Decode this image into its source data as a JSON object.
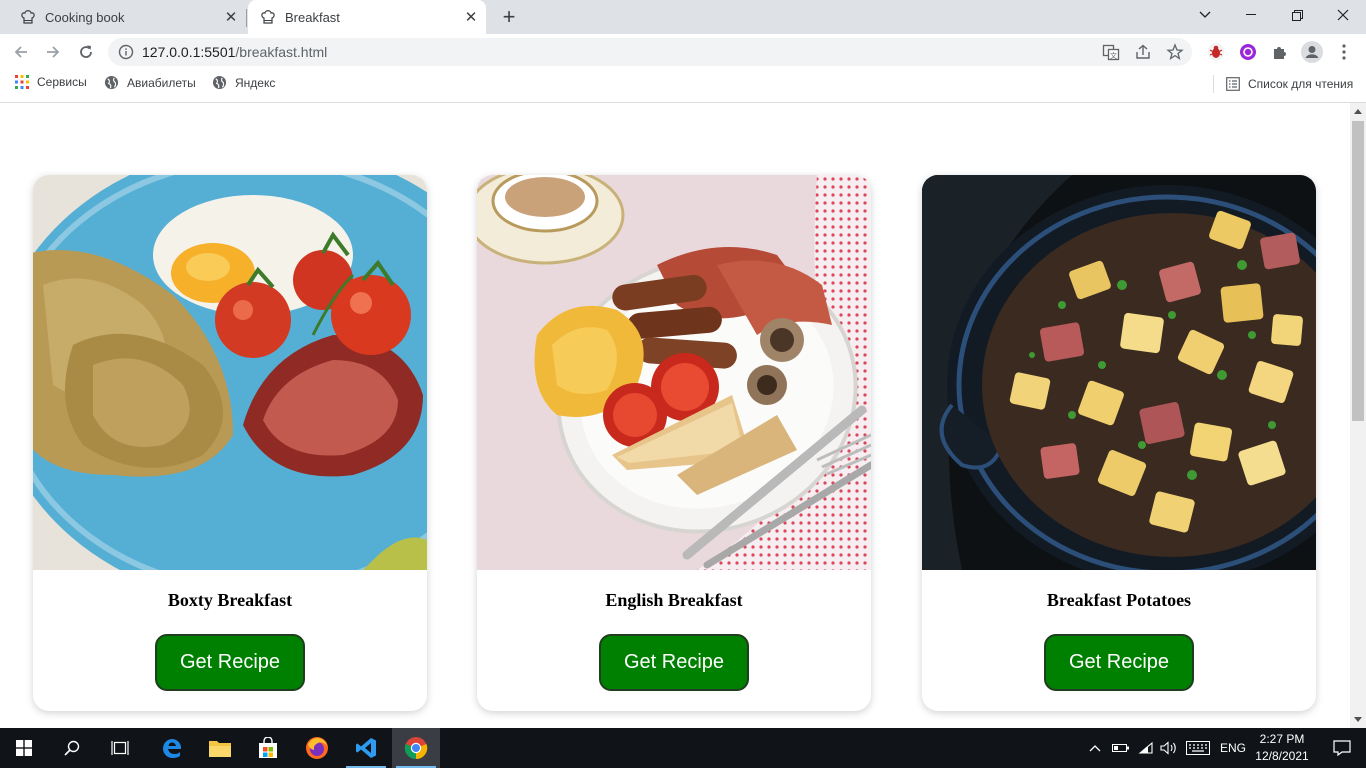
{
  "browser": {
    "tabs": [
      {
        "title": "Cooking book",
        "active": false
      },
      {
        "title": "Breakfast",
        "active": true
      }
    ],
    "url_host": "127.0.0.1:5501",
    "url_path": "/breakfast.html",
    "bookmarks": [
      {
        "label": "Сервисы",
        "icon": "apps-grid-icon"
      },
      {
        "label": "Авиабилеты",
        "icon": "globe-icon"
      },
      {
        "label": "Яндекс",
        "icon": "globe-icon"
      }
    ],
    "reading_list_label": "Список для чтения"
  },
  "page": {
    "cards": [
      {
        "title": "Boxty Breakfast",
        "button": "Get Recipe",
        "image": "boxty-breakfast-photo"
      },
      {
        "title": "English Breakfast",
        "button": "Get Recipe",
        "image": "english-breakfast-photo"
      },
      {
        "title": "Breakfast Potatoes",
        "button": "Get Recipe",
        "image": "breakfast-potatoes-photo"
      }
    ],
    "button_color": "#008000"
  },
  "taskbar": {
    "language": "ENG",
    "time": "2:27 PM",
    "date": "12/8/2021"
  }
}
